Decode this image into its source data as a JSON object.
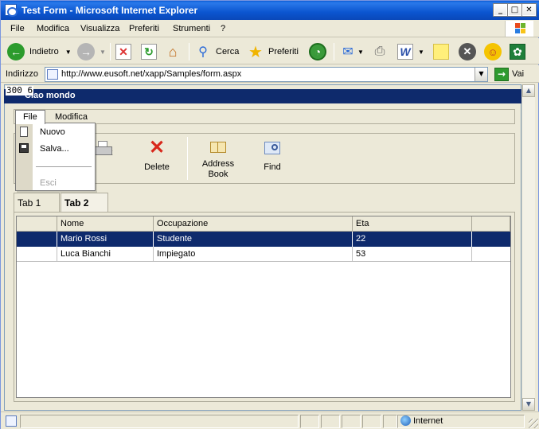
{
  "window": {
    "title": "Test Form - Microsoft Internet Explorer"
  },
  "menubar": {
    "items": [
      "File",
      "Modifica",
      "Visualizza",
      "Preferiti",
      "Strumenti",
      "?"
    ]
  },
  "toolbar": {
    "back_label": "Indietro",
    "search_label": "Cerca",
    "favorites_label": "Preferiti"
  },
  "address": {
    "label": "Indirizzo",
    "url": "http://www.eusoft.net/xapp/Samples/form.aspx",
    "go_label": "Vai"
  },
  "page": {
    "coords": "300 6",
    "app_title": "Ciao mondo",
    "appmenu": [
      "File",
      "Modifica"
    ],
    "file_menu": {
      "items": [
        "Nuovo",
        "Salva...",
        "Esci"
      ]
    },
    "app_toolbar": [
      {
        "label": "Print"
      },
      {
        "label": "Delete"
      },
      {
        "label": "Address Book"
      },
      {
        "label": "Find"
      }
    ],
    "tabs": [
      "Tab 1",
      "Tab 2"
    ],
    "grid": {
      "columns": [
        "Nome",
        "Occupazione",
        "Eta"
      ],
      "rows": [
        [
          "Mario Rossi",
          "Studente",
          "22"
        ],
        [
          "Luca Bianchi",
          "Impiegato",
          "53"
        ]
      ]
    }
  },
  "status": {
    "zone": "Internet"
  },
  "colors": {
    "titlebar": "#0a5bd6",
    "selection": "#0e2a6c",
    "chrome": "#ece9d8"
  }
}
